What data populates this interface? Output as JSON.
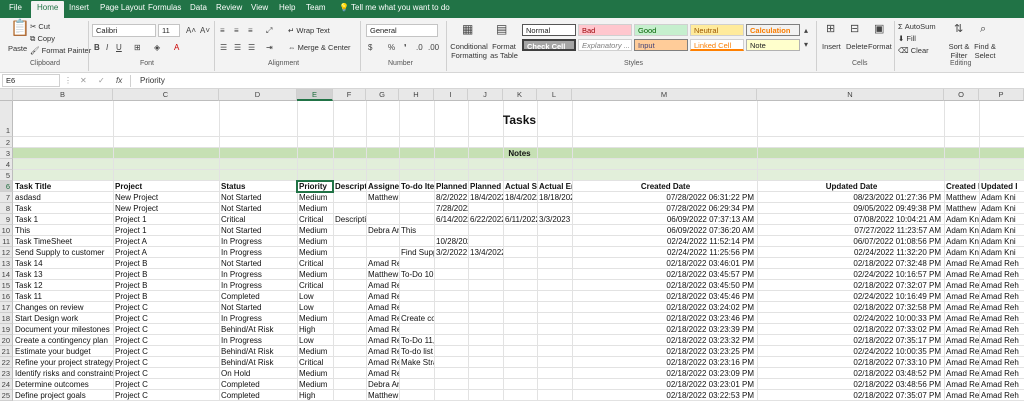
{
  "tabs": [
    "File",
    "Home",
    "Insert",
    "Page Layout",
    "Formulas",
    "Data",
    "Review",
    "View",
    "Help",
    "Team"
  ],
  "tell_me": "Tell me what you want to do",
  "clipboard": {
    "paste": "Paste",
    "cut": "Cut",
    "copy": "Copy",
    "format_painter": "Format Painter",
    "group": "Clipboard"
  },
  "font": {
    "name": "Calibri",
    "size": "11",
    "group": "Font"
  },
  "alignment": {
    "wrap": "Wrap Text",
    "merge": "Merge & Center",
    "group": "Alignment"
  },
  "number": {
    "format": "General",
    "group": "Number"
  },
  "styles": {
    "conditional": "Conditional Formatting",
    "format_table": "Format as Table",
    "normal": "Normal",
    "bad": "Bad",
    "good": "Good",
    "neutral": "Neutral",
    "calculation": "Calculation",
    "check": "Check Cell",
    "explanatory": "Explanatory ...",
    "input": "Input",
    "linked": "Linked Cell",
    "note": "Note",
    "group": "Styles"
  },
  "cells": {
    "insert": "Insert",
    "delete": "Delete",
    "format": "Format",
    "group": "Cells"
  },
  "editing": {
    "autosum": "AutoSum",
    "fill": "Fill",
    "clear": "Clear",
    "sort": "Sort & Filter",
    "find": "Find & Select",
    "group": "Editing"
  },
  "formula_bar": {
    "name_box": "E6",
    "fx": "fx",
    "content": "Priority"
  },
  "colors": {
    "accent": "#217346",
    "band": "#c6e0b4"
  },
  "columns": [
    "B",
    "C",
    "D",
    "E",
    "F",
    "G",
    "H",
    "I",
    "J",
    "K",
    "L",
    "M",
    "N",
    "O",
    "P"
  ],
  "row_numbers": [
    "1",
    "2",
    "3",
    "4",
    "5",
    "6",
    "7",
    "8",
    "9",
    "10",
    "11",
    "12",
    "13",
    "14",
    "15",
    "16",
    "17",
    "18",
    "19",
    "20",
    "21",
    "22",
    "23",
    "24",
    "25"
  ],
  "sheet_title": "Tasks",
  "notes_label": "Notes",
  "headers": [
    "Task Title",
    "Project",
    "Status",
    "Priority",
    "Descriptic",
    "Assignee",
    "To-do Iter",
    "Planned S",
    "Planned E",
    "Actual Sta",
    "Actual End",
    "Created Date",
    "Updated Date",
    "Created B",
    "Updated I"
  ],
  "rows": [
    [
      "asdasd",
      "New Project",
      "Not Started",
      "Medium",
      "",
      "Matthew",
      "",
      "8/2/2022",
      "18/4/2022",
      "18/4/2022",
      "18/18/2022",
      "07/28/2022 06:31:22 PM",
      "08/23/2022 01:27:36 PM",
      "Matthew",
      "Adam Kni"
    ],
    [
      "Task",
      "New Project",
      "Not Started",
      "Medium",
      "",
      "",
      "",
      "7/28/2022",
      "",
      "",
      "",
      "07/28/2022 06:29:34 PM",
      "09/05/2022 09:49:38 PM",
      "Matthew",
      "Adam Kni"
    ],
    [
      "Task 1",
      "Project 1",
      "Critical",
      "Critical",
      "Descriptic",
      "",
      "",
      "6/14/2022",
      "6/22/2022",
      "6/11/2022",
      "3/3/2023",
      "06/09/2022 07:37:13 AM",
      "07/08/2022 10:04:21 AM",
      "Adam Kni",
      "Adam Kni"
    ],
    [
      "This",
      "Project 1",
      "Not Started",
      "Medium",
      "",
      "Debra Ann",
      "This",
      "",
      "",
      "",
      "",
      "06/09/2022 07:36:20 AM",
      "07/27/2022 11:23:57 AM",
      "Adam Kni",
      "Adam Kni"
    ],
    [
      "Task TimeSheet",
      "Project A",
      "In Progress",
      "Medium",
      "",
      "",
      "",
      "10/28/202",
      "",
      "",
      "",
      "02/24/2022 11:52:14 PM",
      "06/07/2022 01:08:56 PM",
      "Adam Kni",
      "Adam Kni"
    ],
    [
      "Send Supply to customer",
      "Project A",
      "In Progress",
      "Medium",
      "",
      "",
      "Find Supp",
      "3/2/2022",
      "13/4/2022",
      "",
      "",
      "02/24/2022 11:25:56 PM",
      "02/24/2022 11:32:20 PM",
      "Adam Kni",
      "Adam Kni"
    ],
    [
      "Task 14",
      "Project B",
      "Not Started",
      "Critical",
      "",
      "Amad Reh",
      "",
      "",
      "",
      "",
      "",
      "02/18/2022 03:46:01 PM",
      "02/18/2022 07:32:48 PM",
      "Amad Reh",
      "Amad Reh"
    ],
    [
      "Task 13",
      "Project B",
      "In Progress",
      "Medium",
      "",
      "Matthew",
      "To-Do 101",
      "",
      "",
      "",
      "",
      "02/18/2022 03:45:57 PM",
      "02/24/2022 10:16:57 PM",
      "Amad Reh",
      "Amad Reh"
    ],
    [
      "Task 12",
      "Project B",
      "In Progress",
      "Critical",
      "",
      "Amad Reh",
      "",
      "",
      "",
      "",
      "",
      "02/18/2022 03:45:50 PM",
      "02/18/2022 07:32:07 PM",
      "Amad Reh",
      "Amad Reh"
    ],
    [
      "Task 11",
      "Project B",
      "Completed",
      "Low",
      "",
      "Amad Reh",
      "",
      "",
      "",
      "",
      "",
      "02/18/2022 03:45:46 PM",
      "02/24/2022 10:16:49 PM",
      "Amad Reh",
      "Amad Reh"
    ],
    [
      "Changes on review",
      "Project C",
      "Not Started",
      "Low",
      "",
      "Amad Reh",
      "",
      "",
      "",
      "",
      "",
      "02/18/2022 03:24:02 PM",
      "02/18/2022 07:32:58 PM",
      "Amad Reh",
      "Amad Reh"
    ],
    [
      "Start Design work",
      "Project C",
      "In Progress",
      "Medium",
      "",
      "Amad Reh",
      "Create col",
      "",
      "",
      "",
      "",
      "02/18/2022 03:23:46 PM",
      "02/24/2022 10:00:33 PM",
      "Amad Reh",
      "Amad Reh"
    ],
    [
      "Document your milestones",
      "Project C",
      "Behind/At Risk",
      "High",
      "",
      "Amad Reh",
      "",
      "",
      "",
      "",
      "",
      "02/18/2022 03:23:39 PM",
      "02/18/2022 07:33:02 PM",
      "Amad Reh",
      "Amad Reh"
    ],
    [
      "Create a contingency plan",
      "Project C",
      "In Progress",
      "Low",
      "",
      "Amad Reh",
      "To-Do 11,",
      "",
      "",
      "",
      "",
      "02/18/2022 03:23:32 PM",
      "02/18/2022 07:35:17 PM",
      "Amad Reh",
      "Amad Reh"
    ],
    [
      "Estimate your budget",
      "Project C",
      "Behind/At Risk",
      "Medium",
      "",
      "Amad Reh",
      "To-do list",
      "",
      "",
      "",
      "",
      "02/18/2022 03:23:25 PM",
      "02/24/2022 10:00:35 PM",
      "Amad Reh",
      "Amad Reh"
    ],
    [
      "Refine your project strategy w",
      "Project C",
      "Behind/At Risk",
      "Critical",
      "",
      "Amad Reh",
      "Make Stra",
      "",
      "",
      "",
      "",
      "02/18/2022 03:23:16 PM",
      "02/18/2022 07:33:10 PM",
      "Amad Reh",
      "Amad Reh"
    ],
    [
      "Identify risks and constraints",
      "Project C",
      "On Hold",
      "Medium",
      "",
      "Amad Reh",
      "",
      "",
      "",
      "",
      "",
      "02/18/2022 03:23:09 PM",
      "02/18/2022 03:48:52 PM",
      "Amad Reh",
      "Amad Reh"
    ],
    [
      "Determine outcomes",
      "Project C",
      "Completed",
      "Medium",
      "",
      "Debra Ann",
      "",
      "",
      "",
      "",
      "",
      "02/18/2022 03:23:01 PM",
      "02/18/2022 03:48:56 PM",
      "Amad Reh",
      "Amad Reh"
    ],
    [
      "Define project goals",
      "Project C",
      "Completed",
      "High",
      "",
      "Matthew",
      "",
      "",
      "",
      "",
      "",
      "02/18/2022 03:22:53 PM",
      "02/18/2022 07:35:07 PM",
      "Amad Reh",
      "Amad Reh"
    ]
  ]
}
